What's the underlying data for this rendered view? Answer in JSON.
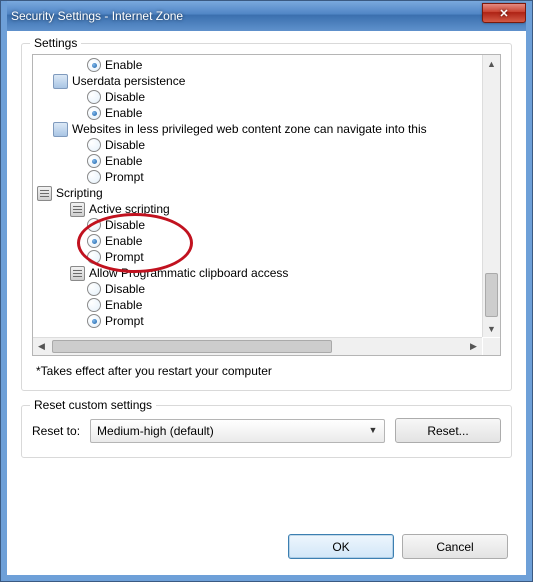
{
  "window": {
    "title": "Security Settings - Internet Zone"
  },
  "settings": {
    "legend": "Settings",
    "note": "*Takes effect after you restart your computer",
    "tree": [
      {
        "type": "radio",
        "indent": 54,
        "label": "Enable",
        "selected": true
      },
      {
        "type": "node",
        "indent": 20,
        "label": "Userdata persistence"
      },
      {
        "type": "radio",
        "indent": 54,
        "label": "Disable",
        "selected": false
      },
      {
        "type": "radio",
        "indent": 54,
        "label": "Enable",
        "selected": true
      },
      {
        "type": "node",
        "indent": 20,
        "label": "Websites in less privileged web content zone can navigate into this"
      },
      {
        "type": "radio",
        "indent": 54,
        "label": "Disable",
        "selected": false
      },
      {
        "type": "radio",
        "indent": 54,
        "label": "Enable",
        "selected": true
      },
      {
        "type": "radio",
        "indent": 54,
        "label": "Prompt",
        "selected": false
      },
      {
        "type": "cat",
        "indent": 4,
        "label": "Scripting"
      },
      {
        "type": "script",
        "indent": 37,
        "label": "Active scripting"
      },
      {
        "type": "radio",
        "indent": 54,
        "label": "Disable",
        "selected": false,
        "annot": "start"
      },
      {
        "type": "radio",
        "indent": 54,
        "label": "Enable",
        "selected": true,
        "annot": "mid"
      },
      {
        "type": "radio",
        "indent": 54,
        "label": "Prompt",
        "selected": false,
        "annot": "end"
      },
      {
        "type": "script",
        "indent": 37,
        "label": "Allow Programmatic clipboard access"
      },
      {
        "type": "radio",
        "indent": 54,
        "label": "Disable",
        "selected": false
      },
      {
        "type": "radio",
        "indent": 54,
        "label": "Enable",
        "selected": false
      },
      {
        "type": "radio",
        "indent": 54,
        "label": "Prompt",
        "selected": true
      }
    ]
  },
  "reset": {
    "legend": "Reset custom settings",
    "label": "Reset to:",
    "selected": "Medium-high (default)",
    "button": "Reset..."
  },
  "buttons": {
    "ok": "OK",
    "cancel": "Cancel"
  }
}
